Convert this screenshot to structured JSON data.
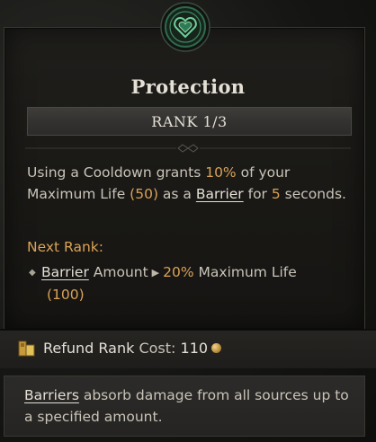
{
  "skill": {
    "icon": "shield-heart-icon",
    "title": "Protection",
    "rank_label": "RANK 1/3"
  },
  "description": {
    "p1": "Using a Cooldown grants ",
    "v1": "10%",
    "p2": " of your Maximum Life ",
    "v2": "(50)",
    "p3": " as a ",
    "link": "Barrier",
    "p4": " for ",
    "v3": "5",
    "p5": " seconds."
  },
  "next_rank": {
    "label": "Next Rank:",
    "link": "Barrier",
    "amount_text": " Amount",
    "value": "20%",
    "suffix": " Maximum Life",
    "extra": "(100)"
  },
  "refund": {
    "label": "Refund Rank",
    "cost_label": " Cost: ",
    "cost_value": "110",
    "icon": "gold-coin-icon"
  },
  "tooltip": {
    "term": "Barriers",
    "text": " absorb damage from all sources up to a specified amount."
  },
  "colors": {
    "highlight": "#d9a257",
    "text": "#c9c4b8",
    "heading": "#e4e0d6",
    "icon_green": "#2f6a4c"
  }
}
